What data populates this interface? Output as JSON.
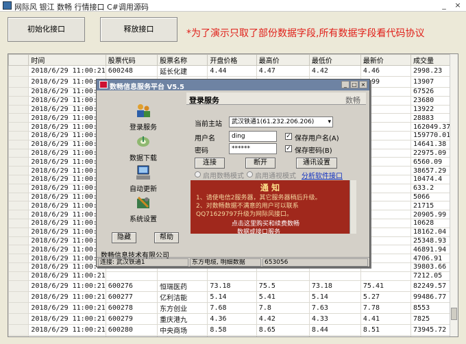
{
  "window": {
    "title": "网际风 银江 数畅 行情接口 C#调用源码",
    "minimize": "_",
    "close": "×"
  },
  "buttons": {
    "init": "初始化接口",
    "release": "释放接口"
  },
  "notice": "*为了演示只取了部份数据字段,所有数据字段看代码协议",
  "table": {
    "headers": [
      "时间",
      "股票代码",
      "股票名称",
      "开盘价格",
      "最高价",
      "最低价",
      "最新价",
      "成交量"
    ],
    "rows": [
      [
        "2018/6/29 11:00:21",
        "600248",
        "延长化建",
        "4.44",
        "4.47",
        "4.42",
        "4.46",
        "2998.23"
      ],
      [
        "2018/6/29 11:00:21",
        "600249",
        "两面针",
        "3.92",
        "4",
        "3.92",
        "3.99",
        "13907"
      ],
      [
        "2018/6/29 11:00:21",
        "",
        "",
        "",
        "",
        "",
        "",
        "67526"
      ],
      [
        "2018/6/29 11:00:21",
        "",
        "",
        "",
        "",
        "",
        "",
        "23680"
      ],
      [
        "2018/6/29 11:00:21",
        "",
        "",
        "",
        "",
        "",
        "",
        "13922"
      ],
      [
        "2018/6/29 11:00:21",
        "",
        "",
        "",
        "",
        "",
        "",
        "28883"
      ],
      [
        "2018/6/29 11:00:21",
        "",
        "",
        "",
        "",
        "",
        "",
        "162049.375"
      ],
      [
        "2018/6/29 11:00:21",
        "",
        "",
        "",
        "",
        "",
        "",
        "159770.016"
      ],
      [
        "2018/6/29 11:00:21",
        "",
        "",
        "",
        "",
        "",
        "",
        "14641.38"
      ],
      [
        "2018/6/29 11:00:21",
        "",
        "",
        "",
        "",
        "",
        "7",
        "22975.09"
      ],
      [
        "2018/6/29 11:00:21",
        "",
        "",
        "",
        "",
        "",
        "9",
        "6560.09"
      ],
      [
        "2018/6/29 11:00:21",
        "",
        "",
        "",
        "",
        "",
        "5",
        "38657.29"
      ],
      [
        "2018/6/29 11:00:21",
        "",
        "",
        "",
        "",
        "",
        "",
        "10474.4"
      ],
      [
        "2018/6/29 11:00:21",
        "",
        "",
        "",
        "",
        "",
        "",
        "633.2"
      ],
      [
        "2018/6/29 11:00:21",
        "",
        "",
        "",
        "",
        "",
        "",
        "5066"
      ],
      [
        "2018/6/29 11:00:21",
        "",
        "",
        "",
        "",
        "",
        "",
        "21715"
      ],
      [
        "2018/6/29 11:00:21",
        "",
        "",
        "",
        "",
        "",
        "",
        "20905.99"
      ],
      [
        "2018/6/29 11:00:21",
        "",
        "",
        "",
        "",
        "",
        "",
        "10628"
      ],
      [
        "2018/6/29 11:00:21",
        "",
        "",
        "",
        "",
        "",
        "",
        "18162.04"
      ],
      [
        "2018/6/29 11:00:21",
        "",
        "",
        "",
        "",
        "",
        "",
        "25348.93"
      ],
      [
        "2018/6/29 11:00:21",
        "",
        "",
        "",
        "",
        "",
        "4",
        "46891.94"
      ],
      [
        "2018/6/29 11:00:21",
        "",
        "",
        "",
        "",
        "",
        "",
        "4706.91"
      ],
      [
        "2018/6/29 11:00:21",
        "",
        "",
        "",
        "",
        "",
        "",
        "39803.66"
      ],
      [
        "2018/6/29 11:00:21",
        "",
        "",
        "",
        "",
        "",
        "",
        "7212.05"
      ],
      [
        "2018/6/29 11:00:21",
        "600276",
        "恒瑞医药",
        "73.18",
        "75.5",
        "73.18",
        "75.41",
        "82249.57"
      ],
      [
        "2018/6/29 11:00:21",
        "600277",
        "亿利洁能",
        "5.14",
        "5.41",
        "5.14",
        "5.27",
        "99486.77"
      ],
      [
        "2018/6/29 11:00:21",
        "600278",
        "东方创业",
        "7.68",
        "7.8",
        "7.63",
        "7.78",
        "8553"
      ],
      [
        "2018/6/29 11:00:21",
        "600279",
        "重庆港九",
        "4.36",
        "4.42",
        "4.33",
        "4.41",
        "7825"
      ],
      [
        "2018/6/29 11:00:21",
        "600280",
        "中央商场",
        "8.58",
        "8.65",
        "8.44",
        "8.51",
        "73945.72"
      ],
      [
        "2018/6/29 11:00:21",
        "600281",
        "太化股份",
        "3.65",
        "3.7",
        "3.63",
        "3.69",
        "4517"
      ],
      [
        "2018/6/29 11:00:21",
        "600282",
        "南钢股份",
        "4.34",
        "4.37",
        "4.21",
        "4.34",
        "303557.844"
      ]
    ],
    "selected_row": 30
  },
  "dialog": {
    "title": "数畅信息服务平台 V5.5",
    "sidebar": [
      "登录服务",
      "数据下载",
      "自动更新",
      "系统设置"
    ],
    "hide_btn": "隐藏",
    "help_btn": "帮助",
    "panel_title": "登录服务",
    "brand": "数畅",
    "server_label": "当前主站",
    "server_value": "武汉铁通1(61.232.206.206)",
    "user_label": "用户名",
    "user_value": "ding",
    "pass_label": "密码",
    "pass_value": "******",
    "save_user": "保存用户名(A)",
    "save_pass": "保存密码(B)",
    "connect": "连接",
    "disconnect": "断开",
    "comm_settings": "通讯设置",
    "mode1": "启用数畅模式",
    "mode2": "启用通视模式",
    "analysis_link": "分析软件接口",
    "news_title": "通  知",
    "news_lines": [
      "1、请使电信2服务器，其它服务器稍后升级。",
      "2、对数畅数据不满意的用户可以联系",
      "QQ71629797升级为网际风接口。",
      "点击这里购买和续费数畅",
      "数据或接口服务"
    ],
    "company": "数畅信息技术有限公司",
    "status": [
      "连接: 武汉铁通1",
      "东方电缆, 明细数据",
      "653056"
    ]
  }
}
